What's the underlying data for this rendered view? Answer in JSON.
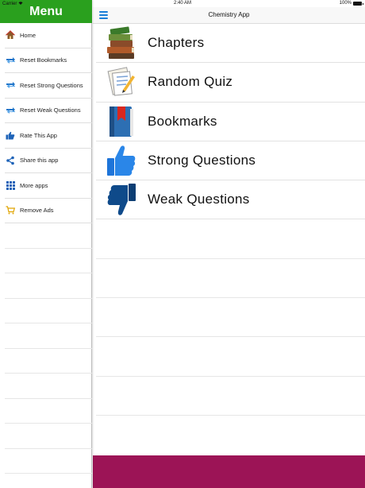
{
  "status_bar": {
    "carrier": "Carrier",
    "time": "2:40 AM",
    "battery": "100%"
  },
  "sidebar": {
    "title": "Menu",
    "header_color": "#2aa01e",
    "items": [
      {
        "label": "Home",
        "icon": "home-icon"
      },
      {
        "label": "Reset Bookmarks",
        "icon": "reset-arrows-icon"
      },
      {
        "label": "Reset Strong Questions",
        "icon": "reset-arrows-icon"
      },
      {
        "label": "Reset Weak Questions",
        "icon": "reset-arrows-icon"
      },
      {
        "label": "Rate This App",
        "icon": "thumbs-up-icon"
      },
      {
        "label": "Share this app",
        "icon": "share-icon"
      },
      {
        "label": "More apps",
        "icon": "grid-icon"
      },
      {
        "label": "Remove Ads",
        "icon": "cart-icon"
      }
    ]
  },
  "nav": {
    "title": "Chemistry App",
    "menu_icon": "hamburger-icon",
    "accent": "#1a7fd8"
  },
  "main_list": [
    {
      "label": "Chapters",
      "icon": "books-icon"
    },
    {
      "label": "Random Quiz",
      "icon": "quiz-paper-icon"
    },
    {
      "label": "Bookmarks",
      "icon": "bookmark-book-icon"
    },
    {
      "label": "Strong Questions",
      "icon": "thumbs-up-icon"
    },
    {
      "label": "Weak Questions",
      "icon": "thumbs-down-icon"
    }
  ],
  "ad_banner_color": "#9c1456"
}
